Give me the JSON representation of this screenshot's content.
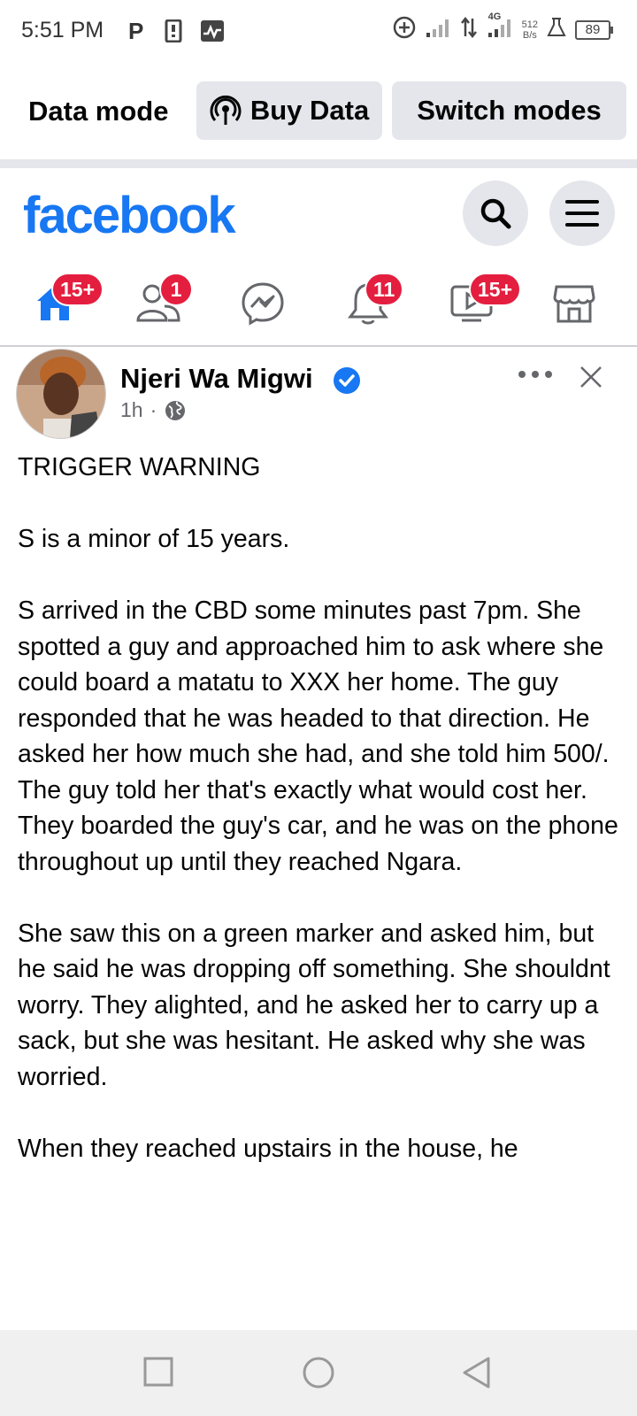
{
  "status_bar": {
    "time": "5:51 PM",
    "net_speed_value": "512",
    "net_speed_unit": "B/s",
    "network_label": "4G",
    "battery": "89"
  },
  "data_mode": {
    "label": "Data mode",
    "buy_data": "Buy Data",
    "switch_modes": "Switch modes"
  },
  "header": {
    "logo": "facebook",
    "brand_color": "#1877f2"
  },
  "nav": {
    "tabs": [
      {
        "name": "home",
        "badge": "15+"
      },
      {
        "name": "friends",
        "badge": "1"
      },
      {
        "name": "messenger",
        "badge": ""
      },
      {
        "name": "notifications",
        "badge": "11"
      },
      {
        "name": "watch",
        "badge": "15+"
      },
      {
        "name": "marketplace",
        "badge": ""
      }
    ]
  },
  "post": {
    "author": "Njeri Wa Migwi",
    "time": "1h",
    "separator": "·",
    "paragraphs": [
      "TRIGGER WARNING",
      "S is a minor of 15 years.",
      "S arrived in the CBD some minutes past 7pm. She spotted a guy and approached him to ask where she could board a matatu to  XXX her home. The guy responded that he was headed to that direction. He asked her how much she had, and she told him 500/. The guy told her that's exactly what would cost her.",
      "They boarded the guy's car, and he was on the phone throughout up until they reached Ngara.",
      "She saw this on a green marker and asked him, but he said he was dropping off something. She shouldnt worry. They alighted, and he asked her to carry up a sack, but she was hesitant. He asked why she was worried.",
      "When they reached upstairs in the house, he"
    ]
  }
}
